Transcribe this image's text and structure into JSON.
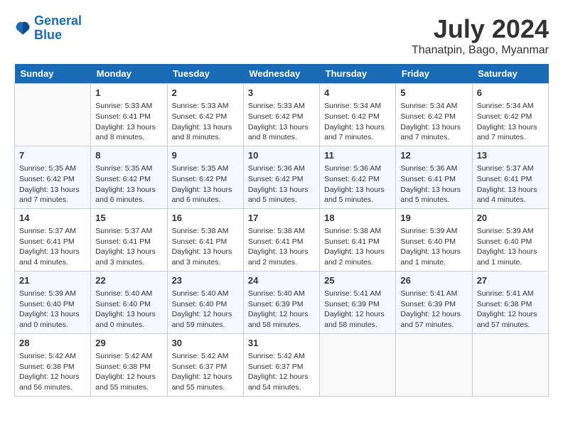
{
  "header": {
    "logo_line1": "General",
    "logo_line2": "Blue",
    "month": "July 2024",
    "location": "Thanatpin, Bago, Myanmar"
  },
  "days_of_week": [
    "Sunday",
    "Monday",
    "Tuesday",
    "Wednesday",
    "Thursday",
    "Friday",
    "Saturday"
  ],
  "weeks": [
    [
      {
        "day": "",
        "empty": true
      },
      {
        "day": "1",
        "sunrise": "Sunrise: 5:33 AM",
        "sunset": "Sunset: 6:41 PM",
        "daylight": "Daylight: 13 hours and 8 minutes."
      },
      {
        "day": "2",
        "sunrise": "Sunrise: 5:33 AM",
        "sunset": "Sunset: 6:42 PM",
        "daylight": "Daylight: 13 hours and 8 minutes."
      },
      {
        "day": "3",
        "sunrise": "Sunrise: 5:33 AM",
        "sunset": "Sunset: 6:42 PM",
        "daylight": "Daylight: 13 hours and 8 minutes."
      },
      {
        "day": "4",
        "sunrise": "Sunrise: 5:34 AM",
        "sunset": "Sunset: 6:42 PM",
        "daylight": "Daylight: 13 hours and 7 minutes."
      },
      {
        "day": "5",
        "sunrise": "Sunrise: 5:34 AM",
        "sunset": "Sunset: 6:42 PM",
        "daylight": "Daylight: 13 hours and 7 minutes."
      },
      {
        "day": "6",
        "sunrise": "Sunrise: 5:34 AM",
        "sunset": "Sunset: 6:42 PM",
        "daylight": "Daylight: 13 hours and 7 minutes."
      }
    ],
    [
      {
        "day": "7",
        "sunrise": "Sunrise: 5:35 AM",
        "sunset": "Sunset: 6:42 PM",
        "daylight": "Daylight: 13 hours and 7 minutes."
      },
      {
        "day": "8",
        "sunrise": "Sunrise: 5:35 AM",
        "sunset": "Sunset: 6:42 PM",
        "daylight": "Daylight: 13 hours and 6 minutes."
      },
      {
        "day": "9",
        "sunrise": "Sunrise: 5:35 AM",
        "sunset": "Sunset: 6:42 PM",
        "daylight": "Daylight: 13 hours and 6 minutes."
      },
      {
        "day": "10",
        "sunrise": "Sunrise: 5:36 AM",
        "sunset": "Sunset: 6:42 PM",
        "daylight": "Daylight: 13 hours and 5 minutes."
      },
      {
        "day": "11",
        "sunrise": "Sunrise: 5:36 AM",
        "sunset": "Sunset: 6:42 PM",
        "daylight": "Daylight: 13 hours and 5 minutes."
      },
      {
        "day": "12",
        "sunrise": "Sunrise: 5:36 AM",
        "sunset": "Sunset: 6:41 PM",
        "daylight": "Daylight: 13 hours and 5 minutes."
      },
      {
        "day": "13",
        "sunrise": "Sunrise: 5:37 AM",
        "sunset": "Sunset: 6:41 PM",
        "daylight": "Daylight: 13 hours and 4 minutes."
      }
    ],
    [
      {
        "day": "14",
        "sunrise": "Sunrise: 5:37 AM",
        "sunset": "Sunset: 6:41 PM",
        "daylight": "Daylight: 13 hours and 4 minutes."
      },
      {
        "day": "15",
        "sunrise": "Sunrise: 5:37 AM",
        "sunset": "Sunset: 6:41 PM",
        "daylight": "Daylight: 13 hours and 3 minutes."
      },
      {
        "day": "16",
        "sunrise": "Sunrise: 5:38 AM",
        "sunset": "Sunset: 6:41 PM",
        "daylight": "Daylight: 13 hours and 3 minutes."
      },
      {
        "day": "17",
        "sunrise": "Sunrise: 5:38 AM",
        "sunset": "Sunset: 6:41 PM",
        "daylight": "Daylight: 13 hours and 2 minutes."
      },
      {
        "day": "18",
        "sunrise": "Sunrise: 5:38 AM",
        "sunset": "Sunset: 6:41 PM",
        "daylight": "Daylight: 13 hours and 2 minutes."
      },
      {
        "day": "19",
        "sunrise": "Sunrise: 5:39 AM",
        "sunset": "Sunset: 6:40 PM",
        "daylight": "Daylight: 13 hours and 1 minute."
      },
      {
        "day": "20",
        "sunrise": "Sunrise: 5:39 AM",
        "sunset": "Sunset: 6:40 PM",
        "daylight": "Daylight: 13 hours and 1 minute."
      }
    ],
    [
      {
        "day": "21",
        "sunrise": "Sunrise: 5:39 AM",
        "sunset": "Sunset: 6:40 PM",
        "daylight": "Daylight: 13 hours and 0 minutes."
      },
      {
        "day": "22",
        "sunrise": "Sunrise: 5:40 AM",
        "sunset": "Sunset: 6:40 PM",
        "daylight": "Daylight: 13 hours and 0 minutes."
      },
      {
        "day": "23",
        "sunrise": "Sunrise: 5:40 AM",
        "sunset": "Sunset: 6:40 PM",
        "daylight": "Daylight: 12 hours and 59 minutes."
      },
      {
        "day": "24",
        "sunrise": "Sunrise: 5:40 AM",
        "sunset": "Sunset: 6:39 PM",
        "daylight": "Daylight: 12 hours and 58 minutes."
      },
      {
        "day": "25",
        "sunrise": "Sunrise: 5:41 AM",
        "sunset": "Sunset: 6:39 PM",
        "daylight": "Daylight: 12 hours and 58 minutes."
      },
      {
        "day": "26",
        "sunrise": "Sunrise: 5:41 AM",
        "sunset": "Sunset: 6:39 PM",
        "daylight": "Daylight: 12 hours and 57 minutes."
      },
      {
        "day": "27",
        "sunrise": "Sunrise: 5:41 AM",
        "sunset": "Sunset: 6:38 PM",
        "daylight": "Daylight: 12 hours and 57 minutes."
      }
    ],
    [
      {
        "day": "28",
        "sunrise": "Sunrise: 5:42 AM",
        "sunset": "Sunset: 6:38 PM",
        "daylight": "Daylight: 12 hours and 56 minutes."
      },
      {
        "day": "29",
        "sunrise": "Sunrise: 5:42 AM",
        "sunset": "Sunset: 6:38 PM",
        "daylight": "Daylight: 12 hours and 55 minutes."
      },
      {
        "day": "30",
        "sunrise": "Sunrise: 5:42 AM",
        "sunset": "Sunset: 6:37 PM",
        "daylight": "Daylight: 12 hours and 55 minutes."
      },
      {
        "day": "31",
        "sunrise": "Sunrise: 5:42 AM",
        "sunset": "Sunset: 6:37 PM",
        "daylight": "Daylight: 12 hours and 54 minutes."
      },
      {
        "day": "",
        "empty": true
      },
      {
        "day": "",
        "empty": true
      },
      {
        "day": "",
        "empty": true
      }
    ]
  ]
}
